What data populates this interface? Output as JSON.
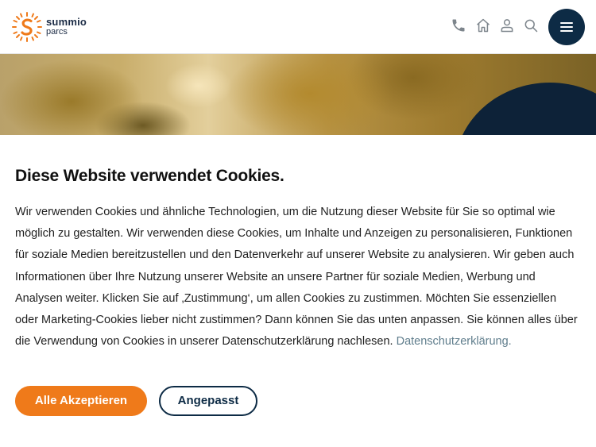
{
  "brand": {
    "name_line1": "summio",
    "name_line2": "parcs",
    "logo_icon": "sun-logo-icon",
    "colors": {
      "primary": "#0d2b45",
      "accent": "#ef7a1a",
      "link": "#5f7d8c"
    }
  },
  "header": {
    "icons": [
      "phone-icon",
      "home-icon",
      "user-icon",
      "search-icon",
      "menu-icon"
    ]
  },
  "cookie_banner": {
    "title": "Diese Website verwendet Cookies.",
    "body": "Wir verwenden Cookies und ähnliche Technologien, um die Nutzung dieser Website für Sie so optimal wie möglich zu gestalten. Wir verwenden diese Cookies, um Inhalte und Anzeigen zu personalisieren, Funktionen für soziale Medien bereitzustellen und den Datenverkehr auf unserer Website zu analysieren. Wir geben auch Informationen über Ihre Nutzung unserer Website an unsere Partner für soziale Medien, Werbung und Analysen weiter. Klicken Sie auf ‚Zustimmung‘, um allen Cookies zu zustimmen. Möchten Sie essenziellen oder Marketing-Cookies lieber nicht zustimmen? Dann können Sie das unten anpassen. Sie können alles über die Verwendung von Cookies in unserer Datenschutzerklärung nachlesen.",
    "privacy_link": "Datenschutzerklärung.",
    "accept_all_label": "Alle Akzeptieren",
    "customize_label": "Angepasst"
  }
}
